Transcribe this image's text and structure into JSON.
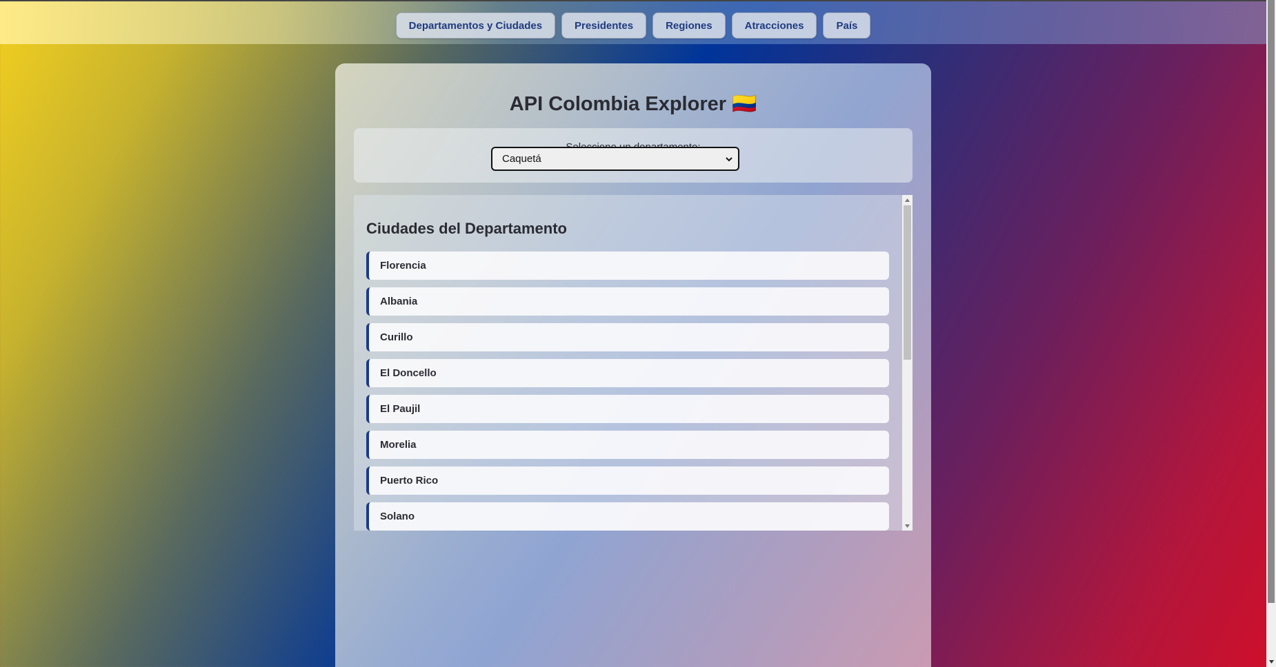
{
  "nav": {
    "items": [
      {
        "label": "Departamentos y Ciudades"
      },
      {
        "label": "Presidentes"
      },
      {
        "label": "Regiones"
      },
      {
        "label": "Atracciones"
      },
      {
        "label": "País"
      }
    ]
  },
  "main": {
    "title": "API Colombia Explorer 🇨🇴",
    "select_label": "Seleccione un departamento:",
    "selected_department": "Caquetá"
  },
  "cities": {
    "heading": "Ciudades del Departamento",
    "items": [
      "Florencia",
      "Albania",
      "Curillo",
      "El Doncello",
      "El Paujil",
      "Morelia",
      "Puerto Rico",
      "Solano"
    ]
  },
  "icons": {
    "select_arrow": "chevron-down-icon",
    "scroll_up": "scroll-up-arrow-icon",
    "scroll_down": "scroll-down-arrow-icon",
    "flag": "colombia-flag-icon"
  },
  "colors": {
    "accent": "#1b3a8c",
    "nav_text": "#1f3a80"
  }
}
